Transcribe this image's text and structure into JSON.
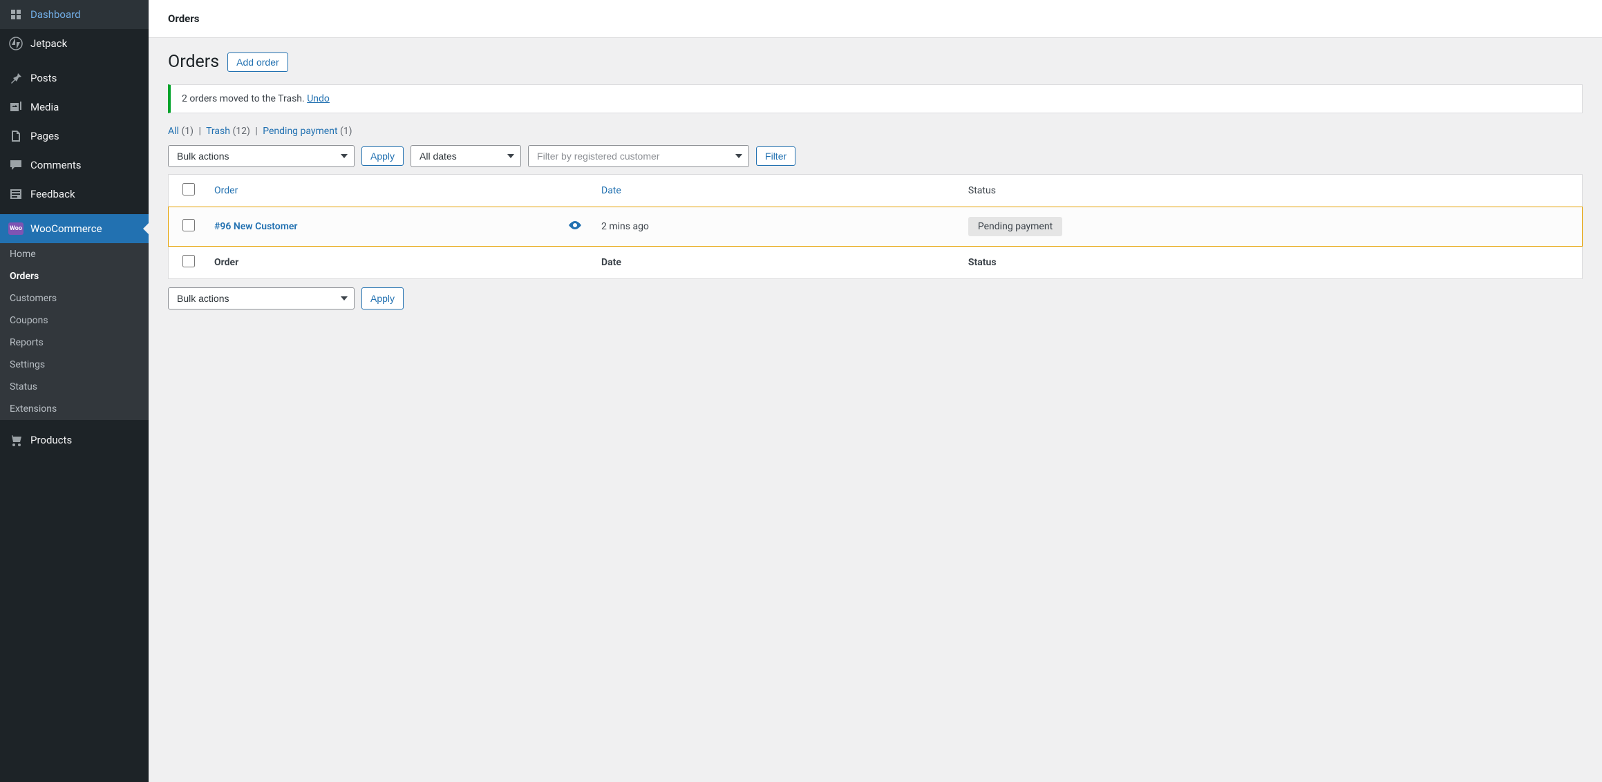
{
  "sidebar": {
    "items": [
      {
        "label": "Dashboard",
        "icon": "dashboard"
      },
      {
        "label": "Jetpack",
        "icon": "jetpack"
      },
      {
        "label": "Posts",
        "icon": "posts"
      },
      {
        "label": "Media",
        "icon": "media"
      },
      {
        "label": "Pages",
        "icon": "pages"
      },
      {
        "label": "Comments",
        "icon": "comments"
      },
      {
        "label": "Feedback",
        "icon": "feedback"
      },
      {
        "label": "WooCommerce",
        "icon": "woo"
      },
      {
        "label": "Products",
        "icon": "products"
      }
    ],
    "submenu": [
      {
        "label": "Home"
      },
      {
        "label": "Orders"
      },
      {
        "label": "Customers"
      },
      {
        "label": "Coupons"
      },
      {
        "label": "Reports"
      },
      {
        "label": "Settings"
      },
      {
        "label": "Status"
      },
      {
        "label": "Extensions"
      }
    ]
  },
  "topbar": {
    "title": "Orders"
  },
  "page": {
    "title": "Orders",
    "add_button": "Add order"
  },
  "notice": {
    "text": "2 orders moved to the Trash.",
    "link": "Undo"
  },
  "filters": {
    "all_label": "All",
    "all_count": "(1)",
    "trash_label": "Trash",
    "trash_count": "(12)",
    "pending_label": "Pending payment",
    "pending_count": "(1)"
  },
  "controls": {
    "bulk_actions": "Bulk actions",
    "apply": "Apply",
    "all_dates": "All dates",
    "filter_customer": "Filter by registered customer",
    "filter_button": "Filter"
  },
  "table": {
    "headers": {
      "order": "Order",
      "date": "Date",
      "status": "Status"
    },
    "rows": [
      {
        "id": "#96 New Customer",
        "date": "2 mins ago",
        "status": "Pending payment"
      }
    ]
  }
}
